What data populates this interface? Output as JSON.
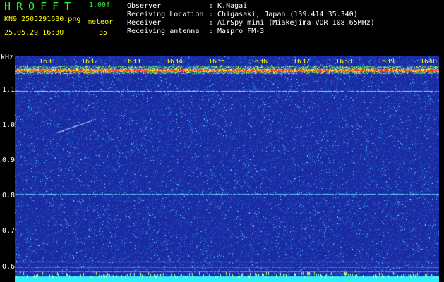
{
  "header": {
    "app_title": "HROFFT",
    "version": "1.00f",
    "filename": "KN9_2505291630.png",
    "meteor_label": "meteor",
    "timestamp": "25.05.29 16:30",
    "meteor_count": "35"
  },
  "info": [
    {
      "label": "Observer",
      "value": ": K.Nagai"
    },
    {
      "label": "Receiving Location",
      "value": ": Chigasaki, Japan (139.414 35.340)"
    },
    {
      "label": "Receiver",
      "value": ": AirSpy mini (Miakejima VOR 108.65MHz)"
    },
    {
      "label": "Receiving antenna",
      "value": ": Maspro FM-3"
    }
  ],
  "spectrogram": {
    "y_unit": "kHz",
    "y_ticks": [
      "1.1",
      "1.0",
      "0.9",
      "0.8",
      "0.7",
      "0.6"
    ],
    "time_ticks": [
      "1631",
      "1632",
      "1633",
      "1634",
      "1635",
      "1636",
      "1637",
      "1638",
      "1639",
      "1640"
    ],
    "colors": {
      "background": "#1a2aa0",
      "band_red": "#ff3020",
      "band_yellow": "#f0f030",
      "noise": "#6fdcff",
      "bottom_band": "#30f0ff",
      "tick_text": "#ffff00"
    }
  }
}
